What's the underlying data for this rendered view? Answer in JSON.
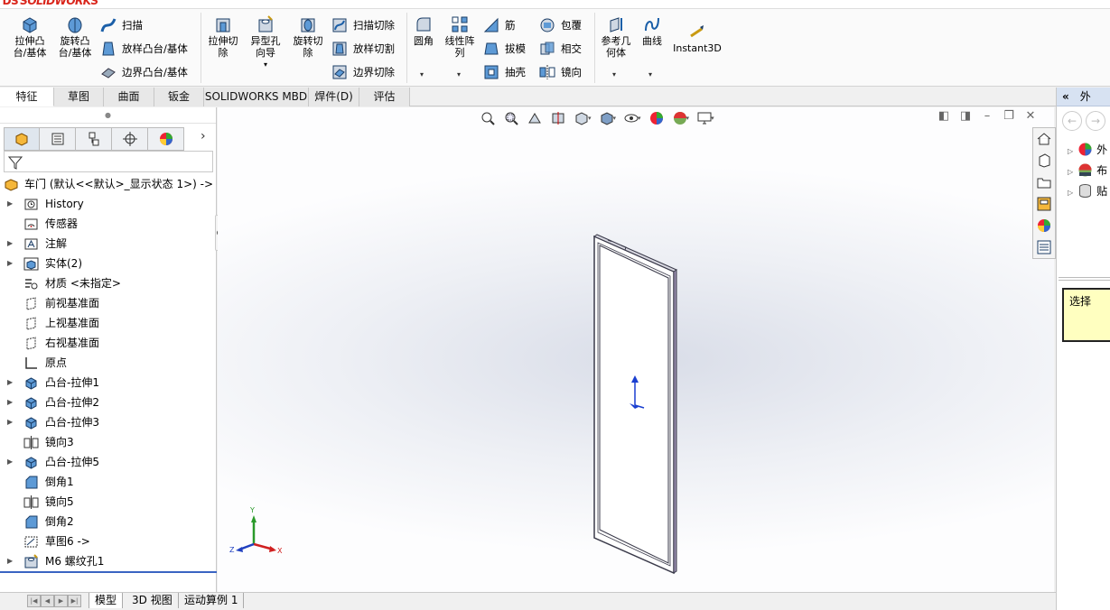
{
  "app": {
    "logo": "SOLIDWORKS"
  },
  "ribbon": {
    "extrude_boss": "拉伸凸\n台/基体",
    "revolve_boss": "旋转凸\n台/基体",
    "sweep": "扫描",
    "loft_boss": "放样凸台/基体",
    "boundary_boss": "边界凸台/基体",
    "extrude_cut": "拉伸切\n除",
    "hole_wizard": "异型孔\n向导",
    "revolve_cut": "旋转切\n除",
    "swept_cut": "扫描切除",
    "lofted_cut": "放样切割",
    "boundary_cut": "边界切除",
    "fillet": "圆角",
    "linear_pattern": "线性阵\n列",
    "rib": "筋",
    "draft": "拔模",
    "shell": "抽壳",
    "wrap": "包覆",
    "intersect": "相交",
    "mirror": "镜向",
    "ref_geometry": "参考几\n何体",
    "curves": "曲线",
    "instant3d": "Instant3D"
  },
  "command_tabs": [
    "特征",
    "草图",
    "曲面",
    "钣金",
    "SOLIDWORKS MBD",
    "焊件(D)",
    "评估"
  ],
  "tree": {
    "root": "车门 (默认<<默认>_显示状态 1>) ->",
    "items": [
      {
        "label": "History",
        "icon": "history-icon",
        "expandable": true
      },
      {
        "label": "传感器",
        "icon": "sensor-icon",
        "expandable": false
      },
      {
        "label": "注解",
        "icon": "annotation-icon",
        "expandable": true
      },
      {
        "label": "实体(2)",
        "icon": "solid-bodies-icon",
        "expandable": true
      },
      {
        "label": "材质 <未指定>",
        "icon": "material-icon",
        "expandable": false
      },
      {
        "label": "前视基准面",
        "icon": "plane-icon",
        "expandable": false
      },
      {
        "label": "上视基准面",
        "icon": "plane-icon",
        "expandable": false
      },
      {
        "label": "右视基准面",
        "icon": "plane-icon",
        "expandable": false
      },
      {
        "label": "原点",
        "icon": "origin-icon",
        "expandable": false
      },
      {
        "label": "凸台-拉伸1",
        "icon": "extrude-icon",
        "expandable": true
      },
      {
        "label": "凸台-拉伸2",
        "icon": "extrude-icon",
        "expandable": true
      },
      {
        "label": "凸台-拉伸3",
        "icon": "extrude-icon",
        "expandable": true
      },
      {
        "label": "镜向3",
        "icon": "mirror-icon",
        "expandable": false
      },
      {
        "label": "凸台-拉伸5",
        "icon": "extrude-icon",
        "expandable": true
      },
      {
        "label": "倒角1",
        "icon": "chamfer-icon",
        "expandable": false
      },
      {
        "label": "镜向5",
        "icon": "mirror-icon",
        "expandable": false
      },
      {
        "label": "倒角2",
        "icon": "chamfer-icon",
        "expandable": false
      },
      {
        "label": "草图6 ->",
        "icon": "sketch-icon",
        "expandable": false
      },
      {
        "label": "M6 螺纹孔1",
        "icon": "hole-icon",
        "expandable": true
      }
    ]
  },
  "triad": {
    "x": "X",
    "y": "Y",
    "z": "Z"
  },
  "taskpane": {
    "header": "外",
    "items": [
      "外",
      "布",
      "贴"
    ],
    "message": "选择"
  },
  "bottom_tabs": [
    "模型",
    "3D 视图",
    "运动算例 1"
  ],
  "colors": {
    "accent": "#3a64c2",
    "part": "#3a3a4a",
    "tip_bg": "#ffffc0"
  }
}
